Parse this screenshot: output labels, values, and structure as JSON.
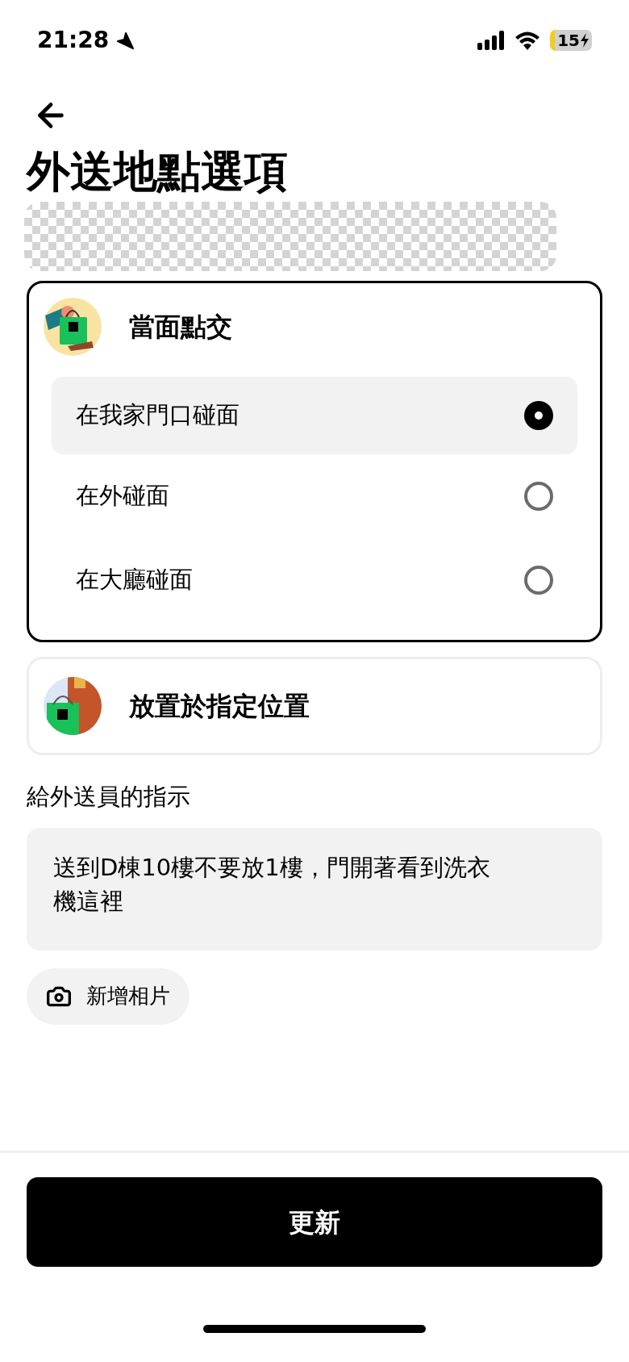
{
  "status_bar": {
    "time": "21:28",
    "battery": "15"
  },
  "title": "外送地點選項",
  "groups": [
    {
      "title": "當面點交",
      "kind": "handoff",
      "selected": true,
      "options": [
        {
          "label": "在我家門口碰面",
          "selected": true
        },
        {
          "label": "在外碰面",
          "selected": false
        },
        {
          "label": "在大廳碰面",
          "selected": false
        }
      ]
    },
    {
      "title": "放置於指定位置",
      "kind": "door",
      "selected": false
    }
  ],
  "instructions": {
    "label": "給外送員的指示",
    "value": "送到D棟10樓不要放1樓，門開著看到洗衣機這裡"
  },
  "add_photo": "新增相片",
  "update_button": "更新"
}
